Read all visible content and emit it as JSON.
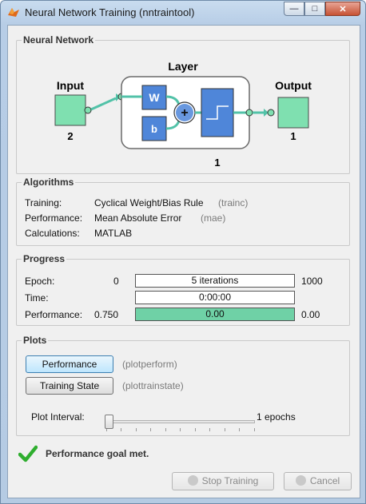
{
  "window": {
    "title": "Neural Network Training (nntraintool)",
    "controls": [
      "—",
      "□",
      "✕"
    ]
  },
  "network": {
    "section_title": "Neural Network",
    "input_label": "Input",
    "input_size": "2",
    "layer_label": "Layer",
    "weight_label": "W",
    "bias_label": "b",
    "layer_size": "1",
    "output_label": "Output",
    "output_size": "1"
  },
  "algorithms": {
    "section_title": "Algorithms",
    "rows": [
      {
        "label": "Training:",
        "value": "Cyclical Weight/Bias Rule",
        "func": "(trainc)"
      },
      {
        "label": "Performance:",
        "value": "Mean Absolute Error",
        "func": "(mae)"
      },
      {
        "label": "Calculations:",
        "value": "MATLAB",
        "func": ""
      }
    ]
  },
  "progress": {
    "section_title": "Progress",
    "epoch": {
      "label": "Epoch:",
      "min": "0",
      "value": "5 iterations",
      "max": "1000"
    },
    "time": {
      "label": "Time:",
      "value": "0:00:00"
    },
    "performance": {
      "label": "Performance:",
      "min": "0.750",
      "value": "0.00",
      "max": "0.00",
      "fill_fraction": 1.0
    }
  },
  "plots": {
    "section_title": "Plots",
    "buttons": [
      {
        "label": "Performance",
        "func": "(plotperform)"
      },
      {
        "label": "Training State",
        "func": "(plottrainstate)"
      }
    ],
    "interval_label": "Plot Interval:",
    "interval_value": "1 epochs",
    "interval_fraction": 0.0
  },
  "status": {
    "message": "Performance goal met."
  },
  "footer": {
    "stop_label": "Stop Training",
    "cancel_label": "Cancel"
  },
  "colors": {
    "node_green": "#7fe0b0",
    "block_blue": "#4f86d9",
    "progress_fill": "#6fd1a6",
    "check_green": "#2fae2f"
  }
}
